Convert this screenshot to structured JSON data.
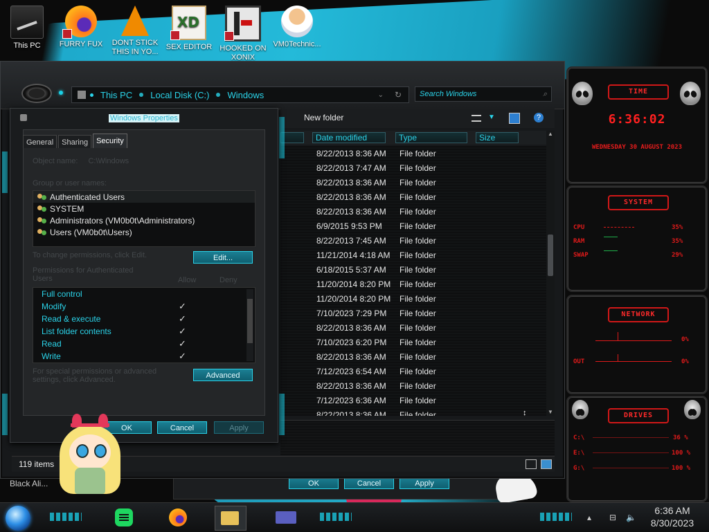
{
  "desktop": {
    "icons": [
      {
        "label": "This PC"
      },
      {
        "label": "FURRY FUX"
      },
      {
        "label": "DONT STICK THIS IN YO..."
      },
      {
        "label": "SEX EDITOR"
      },
      {
        "label": "HOOKED ON XONIX"
      },
      {
        "label": "VM0Technic..."
      }
    ],
    "bottom_label": "Black Ali..."
  },
  "explorer": {
    "breadcrumb": [
      "This PC",
      "Local Disk (C:)",
      "Windows"
    ],
    "search_placeholder": "Search Windows",
    "toolbar_new_folder": "New folder",
    "columns": [
      "Date modified",
      "Type",
      "Size"
    ],
    "rows": [
      {
        "date": "8/22/2013 8:36 AM",
        "type": "File folder"
      },
      {
        "date": "8/22/2013 7:47 AM",
        "type": "File folder"
      },
      {
        "date": "8/22/2013 8:36 AM",
        "type": "File folder"
      },
      {
        "date": "8/22/2013 8:36 AM",
        "type": "File folder"
      },
      {
        "date": "8/22/2013 8:36 AM",
        "type": "File folder"
      },
      {
        "date": "6/9/2015 9:53 PM",
        "type": "File folder"
      },
      {
        "date": "8/22/2013 7:45 AM",
        "type": "File folder"
      },
      {
        "date": "11/21/2014 4:18 AM",
        "type": "File folder"
      },
      {
        "date": "6/18/2015 5:37 AM",
        "type": "File folder"
      },
      {
        "date": "11/20/2014 8:20 PM",
        "type": "File folder"
      },
      {
        "date": "11/20/2014 8:20 PM",
        "type": "File folder"
      },
      {
        "date": "7/10/2023 7:29 PM",
        "type": "File folder"
      },
      {
        "date": "8/22/2013 8:36 AM",
        "type": "File folder"
      },
      {
        "date": "7/10/2023 6:20 PM",
        "type": "File folder"
      },
      {
        "date": "8/22/2013 8:36 AM",
        "type": "File folder"
      },
      {
        "date": "7/12/2023 6:54 AM",
        "type": "File folder"
      },
      {
        "date": "8/22/2013 8:36 AM",
        "type": "File folder"
      },
      {
        "date": "7/12/2023 6:36 AM",
        "type": "File folder"
      },
      {
        "date": "8/22/2013 8:36 AM",
        "type": "File folder"
      }
    ],
    "status_count": "119 items"
  },
  "properties": {
    "title": "Windows Properties",
    "tabs": [
      "General",
      "Sharing",
      "Security"
    ],
    "active_tab": "Security",
    "object_name_label": "Object name:",
    "object_name_value": "C:\\Windows",
    "group_label": "Group or user names:",
    "groups": [
      "Authenticated Users",
      "SYSTEM",
      "Administrators (VM0b0t\\Administrators)",
      "Users (VM0b0t\\Users)"
    ],
    "change_perm_text": "To change permissions, click Edit.",
    "edit_button": "Edit...",
    "perm_for_label": "Permissions for Authenticated Users",
    "allow_label": "Allow",
    "deny_label": "Deny",
    "permissions": [
      {
        "name": "Full control",
        "allow": ""
      },
      {
        "name": "Modify",
        "allow": "✓"
      },
      {
        "name": "Read & execute",
        "allow": "✓"
      },
      {
        "name": "List folder contents",
        "allow": "✓"
      },
      {
        "name": "Read",
        "allow": "✓"
      },
      {
        "name": "Write",
        "allow": "✓"
      }
    ],
    "special_text": "For special permissions or advanced settings, click Advanced.",
    "advanced_button": "Advanced",
    "ok_button": "OK",
    "cancel_button": "Cancel",
    "apply_button": "Apply"
  },
  "back_window": {
    "ok": "OK",
    "cancel": "Cancel",
    "apply": "Apply"
  },
  "gadget": {
    "time_title": "TIME",
    "time": "6:36:02",
    "date": "WEDNESDAY 30 AUGUST 2023",
    "system_title": "SYSTEM",
    "system_rows": [
      {
        "label": "CPU",
        "value": "35%"
      },
      {
        "label": "RAM",
        "value": "35%"
      },
      {
        "label": "SWAP",
        "value": "29%"
      }
    ],
    "network_title": "NETWORK",
    "network_rows": [
      {
        "value": "0%"
      },
      {
        "label": "OUT",
        "value": "0%"
      }
    ],
    "drives_title": "DRIVES",
    "drives": [
      {
        "label": "C:\\",
        "value": "36 %"
      },
      {
        "label": "E:\\",
        "value": "100 %"
      },
      {
        "label": "G:\\",
        "value": "100 %"
      }
    ],
    "accent_color": "#ff2020"
  },
  "taskbar": {
    "time": "6:36 AM",
    "date": "8/30/2023",
    "accent_color": "#1ac4dc"
  }
}
